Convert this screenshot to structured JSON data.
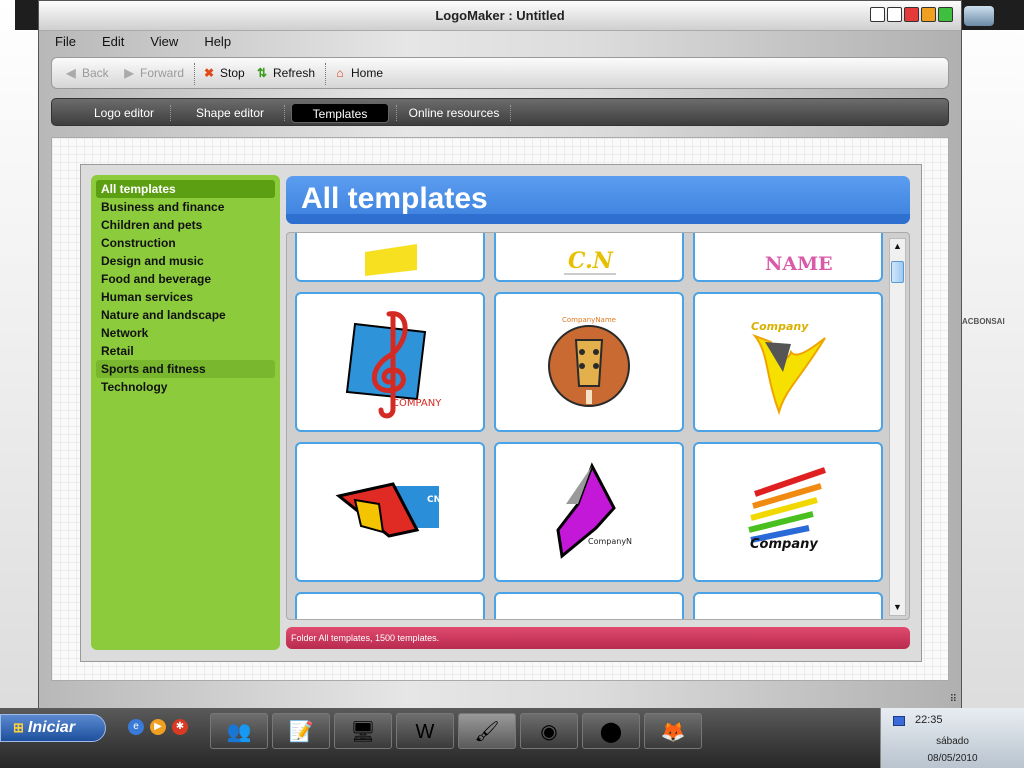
{
  "window": {
    "title": "LogoMaker : Untitled"
  },
  "menu": [
    "File",
    "Edit",
    "View",
    "Help"
  ],
  "toolbar": {
    "back": "Back",
    "forward": "Forward",
    "stop": "Stop",
    "refresh": "Refresh",
    "home": "Home"
  },
  "tabs": [
    {
      "label": "Logo editor",
      "active": false
    },
    {
      "label": "Shape editor",
      "active": false
    },
    {
      "label": "Templates",
      "active": true
    },
    {
      "label": "Online resources",
      "active": false
    }
  ],
  "categories": [
    "All templates",
    "Business and finance",
    "Children and pets",
    "Construction",
    "Design and music",
    "Food and beverage",
    "Human services",
    "Nature and landscape",
    "Network",
    "Retail",
    "Sports and fitness",
    "Technology"
  ],
  "selected_category": "All templates",
  "hovered_category": "Sports and fitness",
  "gallery": {
    "title": "All templates",
    "status": "Folder All templates, 1500 templates.",
    "top_row_text": [
      "",
      "C.N",
      "NAME"
    ],
    "cards": [
      {
        "icon": "treble-clef-logo-icon",
        "text": "COMPANY"
      },
      {
        "icon": "guitar-logo-icon",
        "text": "CompanyName"
      },
      {
        "icon": "flame-logo-icon",
        "text": "Company"
      },
      {
        "icon": "red-wing-head-logo-icon",
        "text": "CN"
      },
      {
        "icon": "purple-arrow-logo-icon",
        "text": "CompanyN"
      },
      {
        "icon": "paint-splash-logo-icon",
        "text": "Company"
      }
    ]
  },
  "desktop": {
    "bonsai_label": "ACBONSAI"
  },
  "taskbar": {
    "start_label": "Iniciar",
    "time": "22:35",
    "day": "sábado",
    "date": "08/05/2010",
    "tasks": [
      "messenger-task-icon",
      "notepad-task-icon",
      "computer-task-icon",
      "word-task-icon",
      "logomaker-task-icon",
      "chrome-task-icon",
      "adv-2009-task-icon",
      "firefox-task-icon"
    ]
  },
  "colors": {
    "sidebar": "#8ccb3c",
    "sidebar_selected": "#5c9f13",
    "header": "#4a8fe8",
    "status": "#c83459",
    "card_border": "#4aa3e6"
  }
}
